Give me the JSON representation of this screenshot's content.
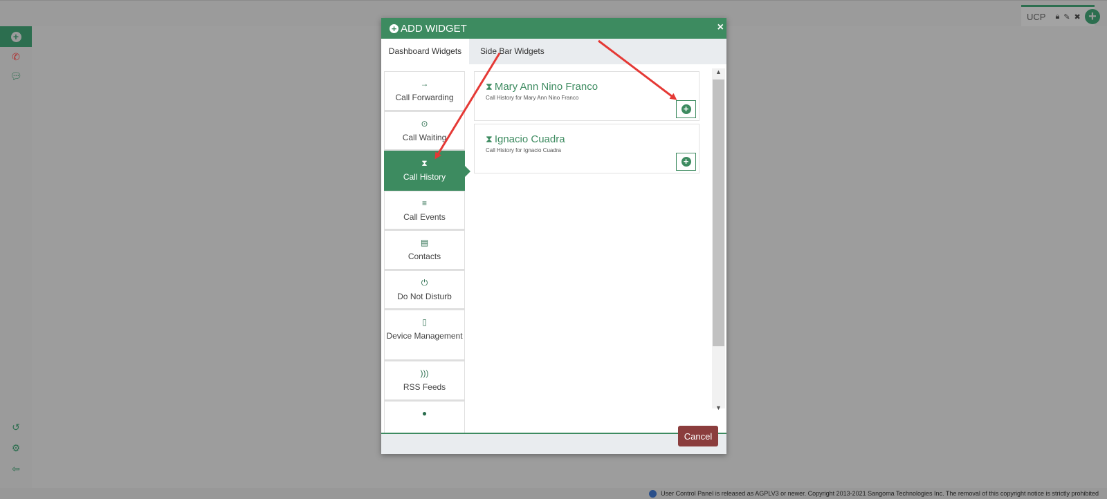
{
  "dashboard": {
    "tab_name": "UCP",
    "lock_icon": "lock-icon",
    "edit_icon": "pencil-icon",
    "close_icon": "close-icon",
    "add_icon": "plus-circle-icon"
  },
  "sidenav": {
    "add_icon": "plus-circle-icon",
    "items": [
      "phone-icon",
      "chat-icon"
    ],
    "bottom_items": [
      "refresh-icon",
      "gear-icon",
      "logout-icon"
    ]
  },
  "modal": {
    "title": "ADD WIDGET",
    "close": "×",
    "tabs": [
      "Dashboard Widgets",
      "Side Bar Widgets"
    ],
    "categories": [
      {
        "label": "Call Forwarding",
        "icon": "→"
      },
      {
        "label": "Call Waiting",
        "icon": "⊙"
      },
      {
        "label": "Call History",
        "icon": "⧗",
        "active": true
      },
      {
        "label": "Call Events",
        "icon": "≡"
      },
      {
        "label": "Contacts",
        "icon": "▤"
      },
      {
        "label": "Do Not Disturb",
        "icon": "⏻"
      },
      {
        "label": "Device Management",
        "icon": "▯"
      },
      {
        "label": "RSS Feeds",
        "icon": ")))"
      }
    ],
    "widgets": [
      {
        "title": "Mary Ann Nino Franco",
        "subtitle": "Call History for Mary Ann Nino Franco"
      },
      {
        "title": "Ignacio Cuadra",
        "subtitle": "Call History for Ignacio Cuadra"
      }
    ],
    "cancel_label": "Cancel"
  },
  "footer": {
    "text": "User Control Panel is released as AGPLV3 or newer. Copyright 2013-2021 Sangoma Technologies Inc. The removal of this copyright notice is strictly prohibited"
  },
  "colors": {
    "accent": "#3d8b60",
    "danger": "#8b3d3d",
    "annotation": "#e53935"
  }
}
